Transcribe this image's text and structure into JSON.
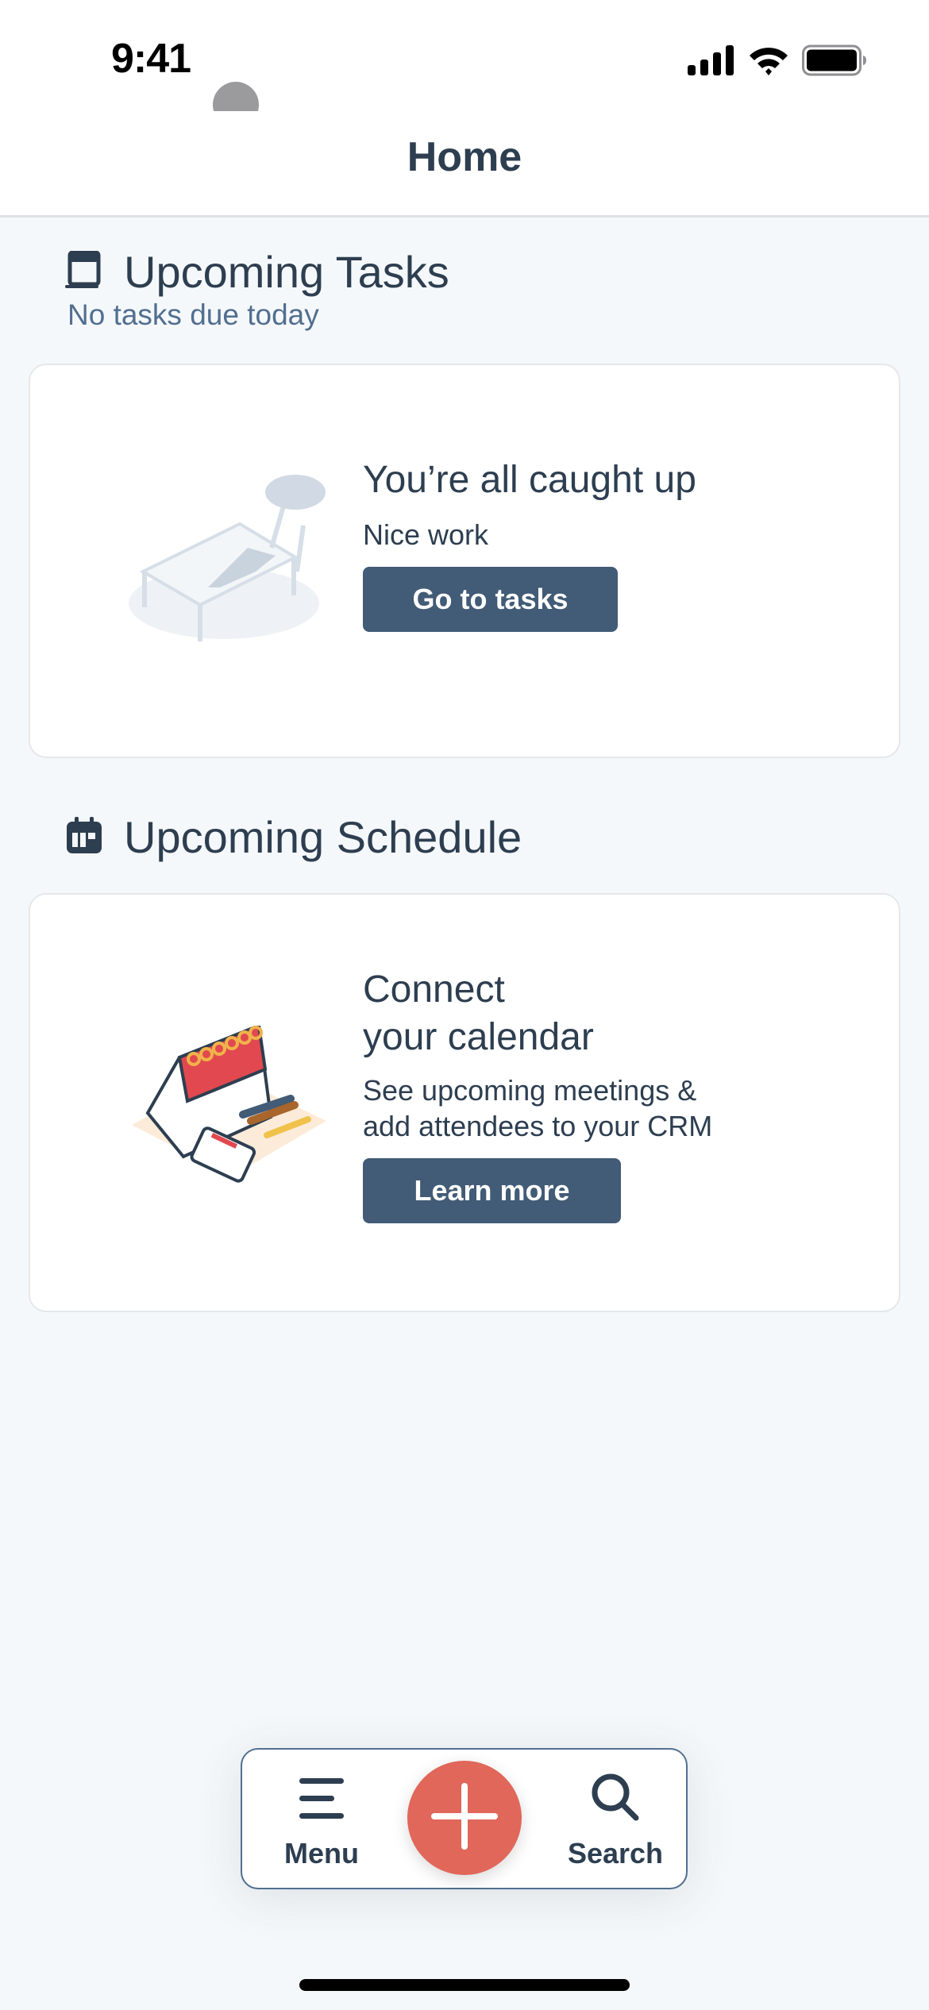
{
  "status_bar": {
    "time": "9:41",
    "icons": [
      "cellular-signal-icon",
      "wifi-icon",
      "battery-icon"
    ]
  },
  "header": {
    "title": "Home"
  },
  "tasks_section": {
    "icon": "task-icon",
    "title": "Upcoming Tasks",
    "subtitle": "No tasks due today",
    "card": {
      "illustration": "person-relaxing-lounge-chair",
      "title": "You’re all caught up",
      "body": "Nice work",
      "button_label": "Go to tasks"
    }
  },
  "schedule_section": {
    "icon": "calendar-icon",
    "title": "Upcoming Schedule",
    "card": {
      "illustration": "desk-calendar-with-pens",
      "title_line1": "Connect",
      "title_line2": "your calendar",
      "body_line1": "See upcoming meetings &",
      "body_line2": "add attendees to your CRM",
      "button_label": "Learn more"
    }
  },
  "bottom_nav": {
    "menu_label": "Menu",
    "search_label": "Search",
    "fab_icon": "plus-icon"
  },
  "colors": {
    "background": "#F5F8FA",
    "text_primary": "#2D3E50",
    "text_secondary": "#516F90",
    "button": "#425B76",
    "fab": "#E0675A"
  }
}
